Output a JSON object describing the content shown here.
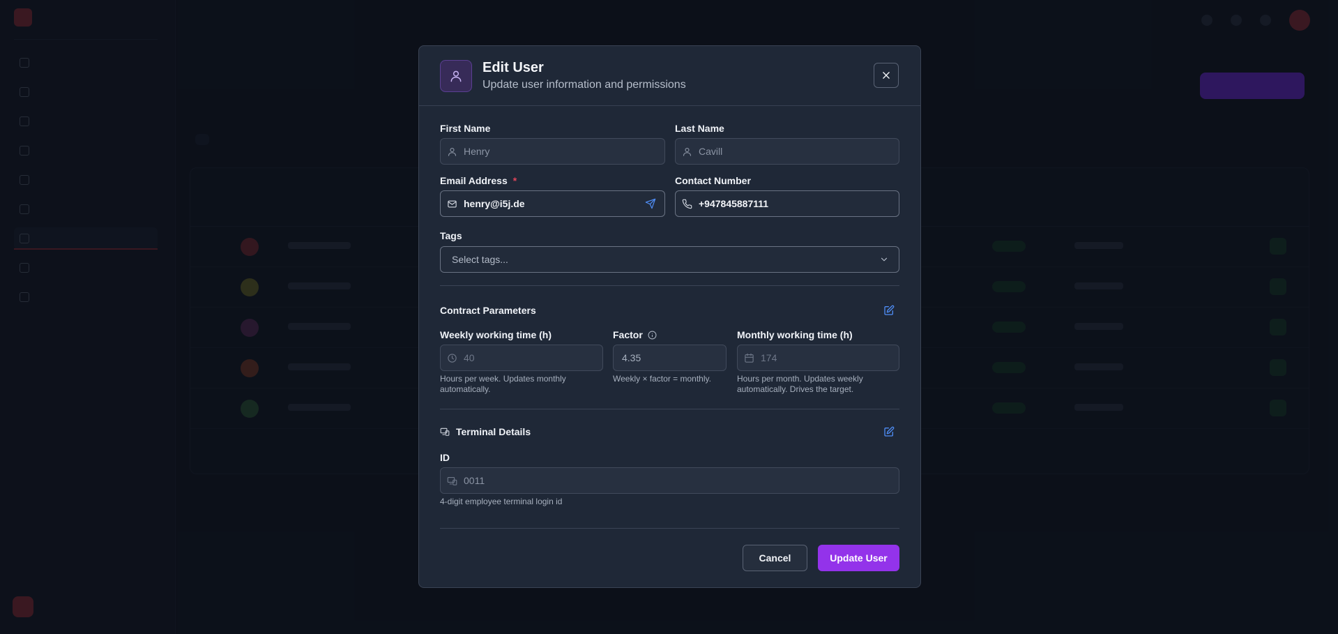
{
  "modal": {
    "title": "Edit User",
    "subtitle": "Update user information and permissions",
    "first_name": {
      "label": "First Name",
      "value": "Henry"
    },
    "last_name": {
      "label": "Last Name",
      "value": "Cavill"
    },
    "email": {
      "label": "Email Address",
      "required_mark": "*",
      "value": "henry@i5j.de"
    },
    "contact": {
      "label": "Contact Number",
      "value": "+947845887111"
    },
    "tags": {
      "label": "Tags",
      "placeholder": "Select tags..."
    },
    "contract": {
      "title": "Contract Parameters",
      "weekly": {
        "label": "Weekly working time (h)",
        "value": "40",
        "hint": "Hours per week. Updates monthly automatically."
      },
      "factor": {
        "label": "Factor",
        "value": "4.35",
        "hint": "Weekly × factor = monthly."
      },
      "monthly": {
        "label": "Monthly working time (h)",
        "value": "174",
        "hint": "Hours per month. Updates weekly automatically. Drives the target."
      }
    },
    "terminal": {
      "title": "Terminal Details",
      "id": {
        "label": "ID",
        "value": "0011",
        "hint": "4-digit employee terminal login id"
      }
    },
    "buttons": {
      "cancel": "Cancel",
      "update": "Update User"
    }
  },
  "colors": {
    "accent": "#9333ea",
    "required": "#e0455a",
    "link_icon": "#4f8df5"
  },
  "icons": [
    "user-icon",
    "close-icon",
    "mail-icon",
    "send-icon",
    "phone-icon",
    "chevron-down-icon",
    "edit-icon",
    "info-icon",
    "clock-icon",
    "calendar-icon",
    "terminal-icon"
  ]
}
